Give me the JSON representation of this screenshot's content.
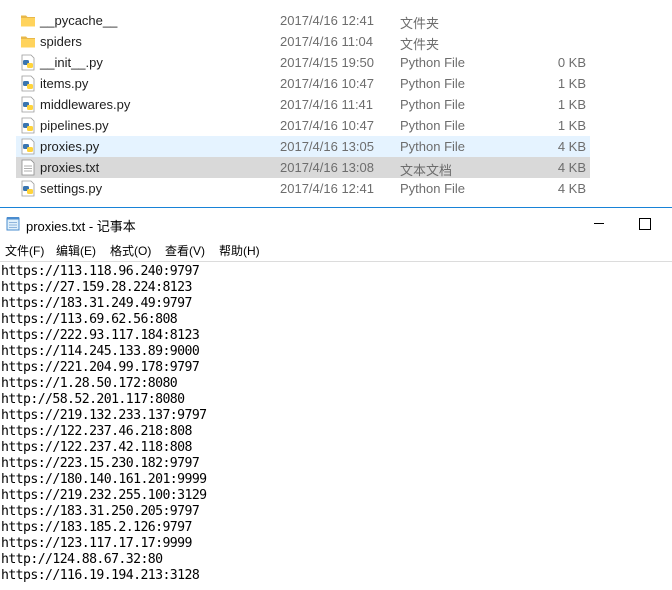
{
  "explorer": {
    "files": [
      {
        "name": "__pycache__",
        "date": "2017/4/16 12:41",
        "type": "文件夹",
        "size": "",
        "icon": "folder-icon"
      },
      {
        "name": "spiders",
        "date": "2017/4/16 11:04",
        "type": "文件夹",
        "size": "",
        "icon": "folder-icon"
      },
      {
        "name": "__init__.py",
        "date": "2017/4/15 19:50",
        "type": "Python File",
        "size": "0 KB",
        "icon": "python-file-icon"
      },
      {
        "name": "items.py",
        "date": "2017/4/16 10:47",
        "type": "Python File",
        "size": "1 KB",
        "icon": "python-file-icon"
      },
      {
        "name": "middlewares.py",
        "date": "2017/4/16 11:41",
        "type": "Python File",
        "size": "1 KB",
        "icon": "python-file-icon"
      },
      {
        "name": "pipelines.py",
        "date": "2017/4/16 10:47",
        "type": "Python File",
        "size": "1 KB",
        "icon": "python-file-icon"
      },
      {
        "name": "proxies.py",
        "date": "2017/4/16 13:05",
        "type": "Python File",
        "size": "4 KB",
        "icon": "python-file-icon"
      },
      {
        "name": "proxies.txt",
        "date": "2017/4/16 13:08",
        "type": "文本文档",
        "size": "4 KB",
        "icon": "text-file-icon"
      },
      {
        "name": "settings.py",
        "date": "2017/4/16 12:41",
        "type": "Python File",
        "size": "4 KB",
        "icon": "python-file-icon"
      }
    ],
    "hover_row": "proxies.py",
    "selected_row": "proxies.txt",
    "colors": {
      "hover": "#e5f3ff",
      "selected": "#d9d9d9",
      "folder": "#ffd35c",
      "python_blue": "#3a75b0",
      "python_yellow": "#ffd43b"
    }
  },
  "notepad": {
    "title": "proxies.txt - 记事本",
    "menu": [
      "文件(F)",
      "编辑(E)",
      "格式(O)",
      "查看(V)",
      "帮助(H)"
    ],
    "lines": [
      "https://113.118.96.240:9797",
      "https://27.159.28.224:8123",
      "https://183.31.249.49:9797",
      "https://113.69.62.56:808",
      "https://222.93.117.184:8123",
      "https://114.245.133.89:9000",
      "https://221.204.99.178:9797",
      "https://1.28.50.172:8080",
      "http://58.52.201.117:8080",
      "https://219.132.233.137:9797",
      "https://122.237.46.218:808",
      "https://122.237.42.118:808",
      "https://223.15.230.182:9797",
      "https://180.140.161.201:9999",
      "https://219.232.255.100:3129",
      "https://183.31.250.205:9797",
      "https://183.185.2.126:9797",
      "https://123.117.17.17:9999",
      "http://124.88.67.32:80",
      "https://116.19.194.213:3128"
    ],
    "border_color": "#1883d7"
  }
}
